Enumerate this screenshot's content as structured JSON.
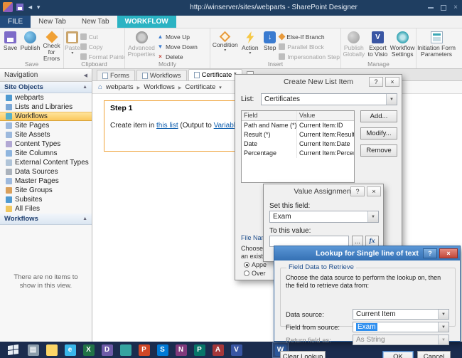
{
  "window": {
    "title": "http://winserver/sites/webparts - SharePoint Designer"
  },
  "icons": {
    "help": "?",
    "close": "×",
    "dropdown": "▼",
    "dropdown_small": "▾",
    "collapse_left": "◀",
    "collapse_up": "▲",
    "home": "⌂",
    "move_up": "▲",
    "move_down": "▼",
    "delete_x": "×",
    "undo": "◄",
    "step_arrow": "↓",
    "visio_letter": "V"
  },
  "ribbon_tabs": [
    {
      "label": "FILE",
      "kind": "file"
    },
    {
      "label": "New Tab"
    },
    {
      "label": "New Tab"
    },
    {
      "label": "WORKFLOW",
      "kind": "workflow",
      "active": true
    }
  ],
  "ribbon": {
    "save": "Save",
    "publish": "Publish",
    "check_for_errors": "Check for Errors",
    "save_group_label": "Save",
    "paste": "Paste",
    "cut": "Cut",
    "copy": "Copy",
    "format_painter": "Format Painter",
    "clipboard_group_label": "Clipboard",
    "advanced_properties": "Advanced Properties",
    "move_up": "Move Up",
    "move_down": "Move Down",
    "delete": "Delete",
    "modify_group_label": "Modify",
    "condition": "Condition",
    "action": "Action",
    "step": "Step",
    "else_if_branch": "Else-If Branch",
    "parallel_block": "Parallel Block",
    "impersonation_step": "Impersonation Step",
    "insert_group_label": "Insert",
    "publish_globally": "Publish Globally",
    "export_to_visio": "Export to Visio",
    "workflow_settings": "Workflow Settings",
    "manage_group_label": "Manage",
    "initiation_form_parameters": "Initiation Form Parameters"
  },
  "nav": {
    "header": "Navigation",
    "site_objects": "Site Objects",
    "items": [
      {
        "label": "webparts",
        "icon": "site-icon"
      },
      {
        "label": "Lists and Libraries",
        "icon": "lists-icon"
      },
      {
        "label": "Workflows",
        "icon": "workflow-icon",
        "selected": true
      },
      {
        "label": "Site Pages",
        "icon": "page-icon"
      },
      {
        "label": "Site Assets",
        "icon": "asset-icon"
      },
      {
        "label": "Content Types",
        "icon": "content-type-icon"
      },
      {
        "label": "Site Columns",
        "icon": "columns-icon"
      },
      {
        "label": "External Content Types",
        "icon": "external-content-icon"
      },
      {
        "label": "Data Sources",
        "icon": "data-source-icon"
      },
      {
        "label": "Master Pages",
        "icon": "master-page-icon"
      },
      {
        "label": "Site Groups",
        "icon": "groups-icon"
      },
      {
        "label": "Subsites",
        "icon": "subsite-icon"
      },
      {
        "label": "All Files",
        "icon": "folder-icon"
      }
    ],
    "workflows_header": "Workflows",
    "empty_message": "There are no items to show in this view."
  },
  "editor": {
    "tabs": [
      {
        "label": "Forms"
      },
      {
        "label": "Workflows"
      },
      {
        "label": "Certificate *",
        "active": true
      }
    ],
    "breadcrumb": [
      {
        "label": "webparts"
      },
      {
        "label": "Workflows"
      },
      {
        "label": "Certificate"
      }
    ],
    "step": {
      "title": "Step 1",
      "text_start": "Create item in ",
      "link_list": "this list",
      "text_mid": " (Output to ",
      "link_variable": "Variable: cr",
      "text_end": ""
    }
  },
  "dialog_create_item": {
    "title": "Create New List Item",
    "list_label": "List:",
    "list_value": "Certificates",
    "columns": [
      "Field",
      "Value"
    ],
    "rows": [
      {
        "field": "Path and Name (*)",
        "value": "Current Item:ID"
      },
      {
        "field": "Result (*)",
        "value": "Current Item:Result"
      },
      {
        "field": "Date",
        "value": "Current Item:Date"
      },
      {
        "field": "Percentage",
        "value": "Current Item:Percentage"
      }
    ],
    "add_button": "Add...",
    "modify_button": "Modify...",
    "remove_button": "Remove",
    "conflict_fragments": {
      "line1": "File Name C",
      "line2": "Choose the",
      "line3": "an existing f",
      "radio1": "Appe",
      "radio2": "Over"
    }
  },
  "dialog_value_assignment": {
    "title": "Value Assignment",
    "set_field_label": "Set this field:",
    "set_field_value": "Exam",
    "to_value_label": "To this value:",
    "browse_button": "...",
    "fx_button": "fx"
  },
  "dialog_lookup": {
    "title": "Lookup for Single line of text",
    "group_label": "Field Data to Retrieve",
    "description": "Choose the data source to perform the lookup on, then the field to retrieve data from:",
    "data_source_label": "Data source:",
    "data_source_value": "Current Item",
    "field_from_source_label": "Field from source:",
    "field_from_source_value": "Exam",
    "return_field_label": "Return field as:",
    "return_field_value": "As String",
    "clear_button": "Clear Lookup",
    "ok_button": "OK",
    "cancel_button": "Cancel"
  },
  "taskbar": {
    "icons": [
      {
        "name": "taskbar-server-manager",
        "glyph": "▤",
        "color": "#8b9cab",
        "fg": "#f2f5f8"
      },
      {
        "name": "taskbar-file-explorer",
        "glyph": "",
        "color": "#fbd567",
        "fg": "#8a6d1f"
      },
      {
        "name": "taskbar-internet-explorer",
        "glyph": "e",
        "color": "#39b7ea",
        "fg": "#ffffff"
      },
      {
        "name": "taskbar-excel",
        "glyph": "X",
        "color": "#217346",
        "fg": "#ffffff"
      },
      {
        "name": "taskbar-sharepoint-designer",
        "glyph": "D",
        "color": "#6e5ba8",
        "fg": "#ffffff"
      },
      {
        "name": "taskbar-app-teal",
        "glyph": "",
        "color": "#35a4a0",
        "fg": "#ffffff"
      },
      {
        "name": "taskbar-powerpoint",
        "glyph": "P",
        "color": "#d04727",
        "fg": "#ffffff"
      },
      {
        "name": "taskbar-lync",
        "glyph": "S",
        "color": "#0079d6",
        "fg": "#ffffff"
      },
      {
        "name": "taskbar-onenote",
        "glyph": "N",
        "color": "#80397b",
        "fg": "#ffffff"
      },
      {
        "name": "taskbar-publisher",
        "glyph": "P",
        "color": "#077568",
        "fg": "#ffffff"
      },
      {
        "name": "taskbar-access",
        "glyph": "A",
        "color": "#a4373a",
        "fg": "#ffffff"
      },
      {
        "name": "taskbar-visio",
        "glyph": "V",
        "color": "#3955a3",
        "fg": "#ffffff"
      },
      {
        "name": "taskbar-word",
        "glyph": "W",
        "color": "#2b579a",
        "fg": "#ffffff",
        "active": true,
        "gap": 36
      }
    ]
  }
}
